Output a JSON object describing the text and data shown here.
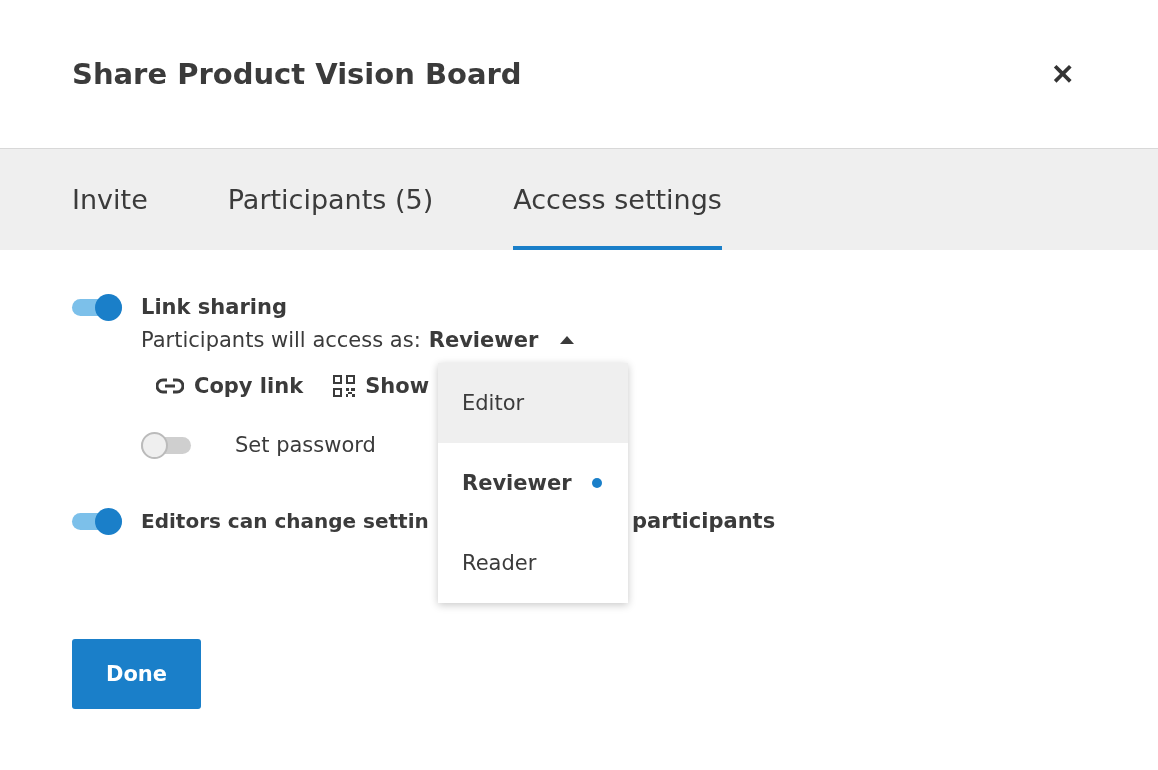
{
  "dialog": {
    "title": "Share Product Vision Board",
    "close": "✕"
  },
  "tabs": [
    {
      "label": "Invite",
      "selected": false
    },
    {
      "label": "Participants (5)",
      "selected": false
    },
    {
      "label": "Access settings",
      "selected": true
    }
  ],
  "link_sharing": {
    "on": true,
    "label": "Link sharing",
    "access_prefix": "Participants will access as:",
    "access_value": "Reviewer",
    "dropdown_expanded": true
  },
  "actions": [
    {
      "kind": "link",
      "label": "Copy link"
    },
    {
      "kind": "qr",
      "label": "Show"
    }
  ],
  "password": {
    "on": false,
    "label": "Set password"
  },
  "editors_setting": {
    "on": true,
    "label_visible_start": "Editors can change settin",
    "label_visible_end": "participants"
  },
  "role_menu": [
    {
      "label": "Editor",
      "selected": false,
      "hovered": true
    },
    {
      "label": "Reviewer",
      "selected": true,
      "hovered": false
    },
    {
      "label": "Reader",
      "selected": false,
      "hovered": false
    }
  ],
  "done_button": "Done"
}
